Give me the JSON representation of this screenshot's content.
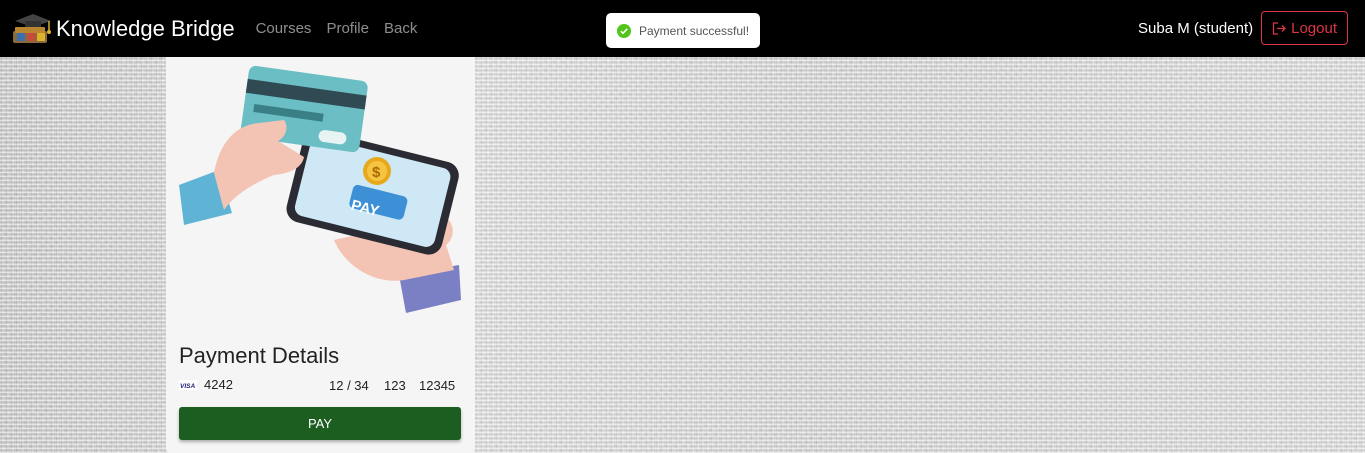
{
  "navbar": {
    "brand": "Knowledge Bridge",
    "links": [
      "Courses",
      "Profile",
      "Back"
    ],
    "user": "Suba M (student)",
    "logout_label": "Logout"
  },
  "toast": {
    "message": "Payment successful!",
    "icon": "check-circle-icon",
    "color": "#52c41a"
  },
  "payment": {
    "title": "Payment Details",
    "card_brand": "VISA",
    "card_number": "4242",
    "expiry": "12 / 34",
    "cvc": "123",
    "zip": "12345",
    "pay_label": "PAY",
    "illustration_pay_text": "PAY",
    "illustration_coin": "$"
  },
  "colors": {
    "pay_button": "#1b5e20",
    "logout": "#dc3545",
    "navbar": "#000000"
  }
}
